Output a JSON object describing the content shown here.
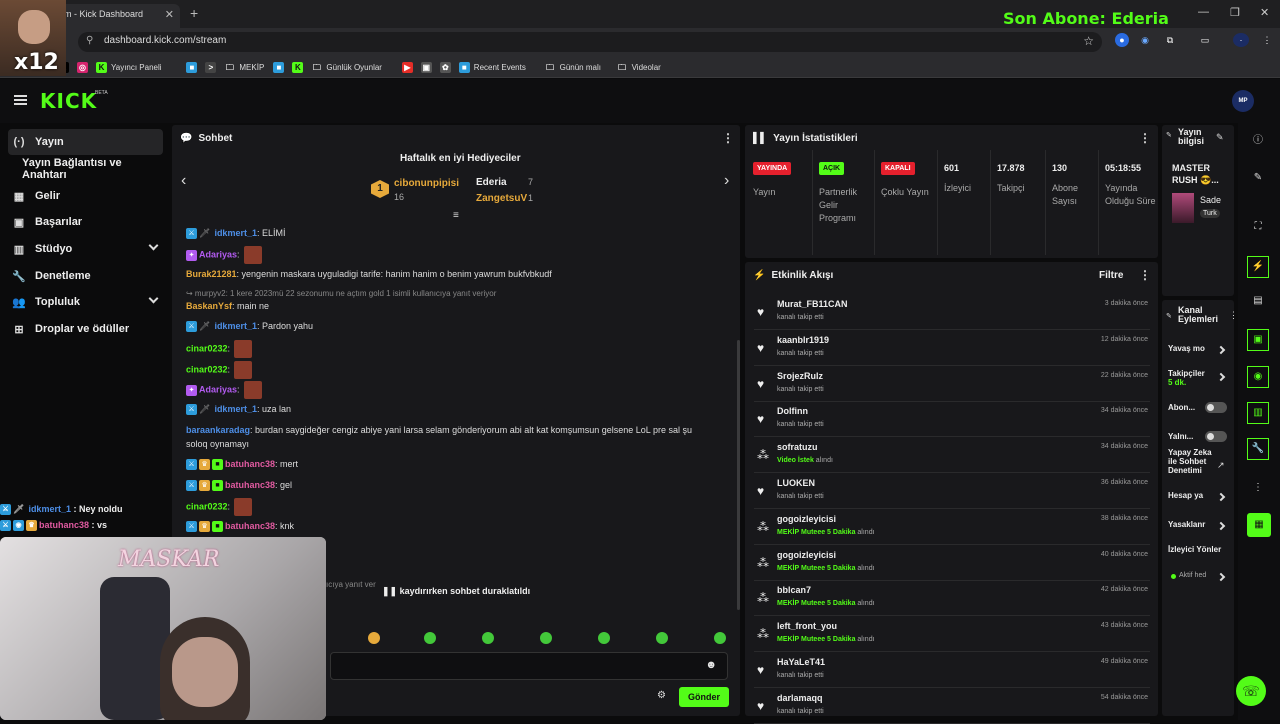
{
  "browser": {
    "tab_title": "m - Kick Dashboard",
    "url": "dashboard.kick.com/stream",
    "bookmarks": [
      {
        "label": "",
        "icon": "x-icon"
      },
      {
        "label": "",
        "icon": "instagram-icon"
      },
      {
        "label": "Yayıncı Paneli",
        "icon": "kick-icon"
      },
      {
        "label": "",
        "icon": "app-icon"
      },
      {
        "label": "",
        "icon": "terminal-icon"
      },
      {
        "label": "MEKİP",
        "icon": "folder-icon"
      },
      {
        "label": "",
        "icon": "app-icon"
      },
      {
        "label": "",
        "icon": "kick-icon"
      },
      {
        "label": "Günlük Oyunlar",
        "icon": "folder-icon"
      },
      {
        "label": "",
        "icon": "youtube-icon"
      },
      {
        "label": "",
        "icon": "image-icon"
      },
      {
        "label": "",
        "icon": "openai-icon"
      },
      {
        "label": "Recent Events",
        "icon": "app-icon"
      },
      {
        "label": "Günün malı",
        "icon": "folder-icon"
      },
      {
        "label": "Videolar",
        "icon": "folder-icon"
      }
    ]
  },
  "overlay": {
    "multiplier": "x12",
    "son_abone": "Son Abone: Ederia",
    "cam_signature": "MASKAR",
    "chat": [
      {
        "user": "idkmert_1",
        "text": " : Ney noldu"
      },
      {
        "user": "batuhanc38",
        "text": " : vs"
      }
    ]
  },
  "app": {
    "logo": "KICK",
    "logo_badge": "BETA"
  },
  "sidebar": {
    "items": [
      {
        "label": "Yayın",
        "icon": "(·)"
      },
      {
        "label": "Yayın Bağlantısı ve Anahtarı",
        "icon": ""
      },
      {
        "label": "Gelir",
        "icon": "▦"
      },
      {
        "label": "Başarılar",
        "icon": "▣"
      },
      {
        "label": "Stüdyo",
        "icon": "▥"
      },
      {
        "label": "Denetleme",
        "icon": "🔧"
      },
      {
        "label": "Topluluk",
        "icon": "👥"
      },
      {
        "label": "Droplar ve ödüller",
        "icon": "⊞"
      }
    ]
  },
  "chat": {
    "title": "Sohbet",
    "gifters_title": "Haftalık en iyi Hediyeciler",
    "gifters": [
      {
        "rank": "1",
        "name": "cibonunpipisi",
        "count": "16"
      },
      {
        "rank": "2",
        "name": "Ederia",
        "count": "7"
      },
      {
        "rank": "3",
        "name": "ZangetsuV",
        "count": "1"
      }
    ],
    "messages": [
      {
        "user": "idkmert_1",
        "text": ": ELİMİ"
      },
      {
        "user": "Adariyas",
        "text": ":"
      },
      {
        "user": "Burak21281",
        "text": ": yengenin maskara uyguladigi tarife: hanim hanim o benim yawrum bukfvbkudf"
      },
      {
        "user": "",
        "text": "↪ murpyv2: 1 kere 2023mü 22 sezonumu ne açtım gold 1 isimli kullanıcıya yanıt veriyor"
      },
      {
        "user": "BaskanYsf",
        "text": ": main ne"
      },
      {
        "user": "idkmert_1",
        "text": ": Pardon yahu"
      },
      {
        "user": "cinar0232",
        "text": ":"
      },
      {
        "user": "cinar0232",
        "text": ":"
      },
      {
        "user": "Adariyas",
        "text": ":"
      },
      {
        "user": "idkmert_1",
        "text": ": uza lan"
      },
      {
        "user": "baraankaradag",
        "text": ": burdan saygideğer cengiz abiye yani larsa selam gönderiyorum abi alt kat komşumsun gelsene LoL pre sal şu soloq oynamayı"
      },
      {
        "user": "batuhanc38",
        "text": ": mert"
      },
      {
        "user": "batuhanc38",
        "text": ": gel"
      },
      {
        "user": "cinar0232",
        "text": ":"
      },
      {
        "user": "batuhanc38",
        "text": ": knk"
      }
    ],
    "reply_fragment": "ıcıya yanıt ver",
    "paused": "kaydırırken sohbet duraklatıldı",
    "send": "Gönder"
  },
  "stats": {
    "title": "Yayın İstatistikleri",
    "cols": [
      {
        "badge": "YAYINDA",
        "label": "Yayın",
        "color": "#e5202d"
      },
      {
        "badge": "AÇIK",
        "label": "Partnerlik Gelir Programı",
        "color": "#53fc18"
      },
      {
        "badge": "KAPALI",
        "label": "Çoklu Yayın",
        "color": "#e5202d"
      },
      {
        "num": "601",
        "label": "İzleyici"
      },
      {
        "num": "17.878",
        "label": "Takipçi"
      },
      {
        "num": "130",
        "label": "Abone Sayısı"
      },
      {
        "num": "05:18:55",
        "label": "Yayında Olduğu Süre"
      }
    ]
  },
  "activity": {
    "title": "Etkinlik Akışı",
    "filter": "Filtre",
    "events": [
      {
        "name": "Murat_FB11CAN",
        "sub": "kanalı takip etti",
        "time": "3 dakika önce",
        "type": "follow"
      },
      {
        "name": "kaanblr1919",
        "sub": "kanalı takip etti",
        "time": "12 dakika önce",
        "type": "follow"
      },
      {
        "name": "SrojezRulz",
        "sub": "kanalı takip etti",
        "time": "22 dakika önce",
        "type": "follow"
      },
      {
        "name": "Dolfinn",
        "sub": "kanalı takip etti",
        "time": "34 dakika önce",
        "type": "follow"
      },
      {
        "name": "sofratuzu",
        "sub_hl": "Video İstek",
        "sub": " alındı",
        "time": "34 dakika önce",
        "type": "reward"
      },
      {
        "name": "LUOKEN",
        "sub": "kanalı takip etti",
        "time": "36 dakika önce",
        "type": "follow"
      },
      {
        "name": "gogoizleyicisi",
        "sub_hl": "MEKİP Muteee 5 Dakika",
        "sub": " alındı",
        "time": "38 dakika önce",
        "type": "reward"
      },
      {
        "name": "gogoizleyicisi",
        "sub_hl": "MEKİP Muteee 5 Dakika",
        "sub": " alındı",
        "time": "40 dakika önce",
        "type": "reward"
      },
      {
        "name": "bblcan7",
        "sub_hl": "MEKİP Muteee 5 Dakika",
        "sub": " alındı",
        "time": "42 dakika önce",
        "type": "reward"
      },
      {
        "name": "left_front_you",
        "sub_hl": "MEKİP Muteee 5 Dakika",
        "sub": " alındı",
        "time": "43 dakika önce",
        "type": "reward"
      },
      {
        "name": "HaYaLeT41",
        "sub": "kanalı takip etti",
        "time": "49 dakika önce",
        "type": "follow"
      },
      {
        "name": "darlamaqq",
        "sub": "kanalı takip etti",
        "time": "54 dakika önce",
        "type": "follow"
      }
    ]
  },
  "stream_info": {
    "title": "Yayın bilgisi",
    "stream_title": "MASTER RUSH 😎...",
    "category": "Sade",
    "lang": "Turk"
  },
  "channel_actions": {
    "title": "Kanal Eylemleri",
    "items": [
      {
        "label": "Yavaş mo",
        "kind": "chev"
      },
      {
        "label": "Takipçiler",
        "value": "5 dk.",
        "kind": "chev"
      },
      {
        "label": "Abon...",
        "kind": "toggle"
      },
      {
        "label": "Yalnı...",
        "kind": "toggle"
      },
      {
        "label": "Yapay Zeka ile Sohbet Denetimi",
        "kind": "ext"
      },
      {
        "label": "Hesap ya",
        "kind": "chev"
      },
      {
        "label": "Yasaklanr",
        "kind": "chev"
      },
      {
        "label": "İzleyici Yönler",
        "kind": "none"
      },
      {
        "label": "Aktif hed",
        "kind": "chev"
      }
    ]
  }
}
